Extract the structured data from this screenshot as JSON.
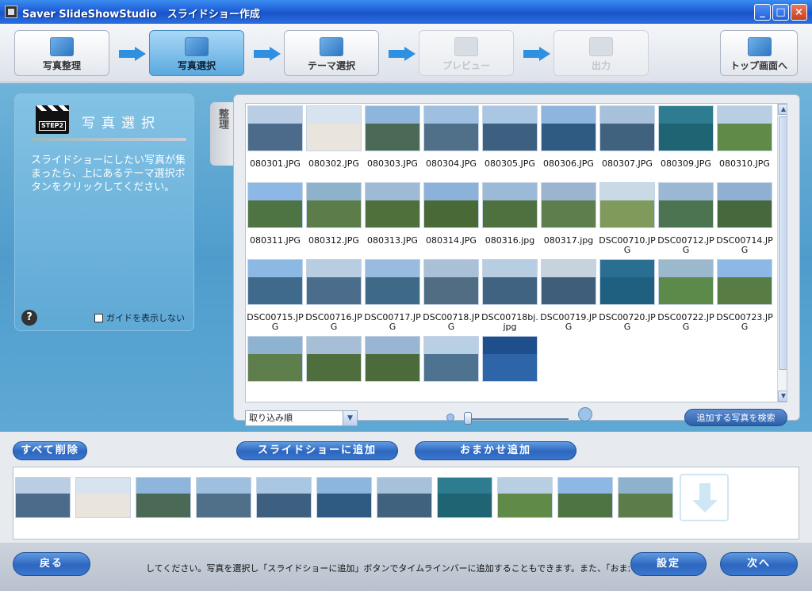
{
  "window": {
    "title": "Saver SlideShowStudio　スライドショー作成",
    "minimize": "_",
    "maximize": "□",
    "close": "×"
  },
  "steps": [
    {
      "label": "写真整理",
      "state": "normal"
    },
    {
      "label": "写真選択",
      "state": "active"
    },
    {
      "label": "テーマ選択",
      "state": "normal"
    },
    {
      "label": "プレビュー",
      "state": "disabled"
    },
    {
      "label": "出力",
      "state": "disabled"
    }
  ],
  "top_screen_button": "トップ画面へ",
  "guide": {
    "badge": "STEP2",
    "title": "写真選択",
    "text": "スライドショーにしたい写真が集まったら、上にあるテーマ選択ボタンをクリックしてください。",
    "help": "?",
    "hide_guide_label": "ガイドを表示しない"
  },
  "side_tab": "整理",
  "photos": [
    {
      "name": "080301.JPG",
      "sky": "#b9cde4",
      "ground": "#4c6b8a"
    },
    {
      "name": "080302.JPG",
      "sky": "#d7e3ee",
      "ground": "#e9e4dc"
    },
    {
      "name": "080303.JPG",
      "sky": "#8eb6dc",
      "ground": "#4b6a56"
    },
    {
      "name": "080304.JPG",
      "sky": "#9ebfe0",
      "ground": "#50708a"
    },
    {
      "name": "080305.JPG",
      "sky": "#a9c6e3",
      "ground": "#3d5f80"
    },
    {
      "name": "080306.JPG",
      "sky": "#8db5de",
      "ground": "#2f5a82"
    },
    {
      "name": "080307.JPG",
      "sky": "#a7c1da",
      "ground": "#41627f"
    },
    {
      "name": "080309.JPG",
      "sky": "#2d7c8f",
      "ground": "#1e6473"
    },
    {
      "name": "080310.JPG",
      "sky": "#b8cfe3",
      "ground": "#5f8a48"
    },
    {
      "name": "080311.JPG",
      "sky": "#8db8e6",
      "ground": "#4d7442"
    },
    {
      "name": "080312.JPG",
      "sky": "#8fb2cc",
      "ground": "#5c7d4a"
    },
    {
      "name": "080313.JPG",
      "sky": "#9fbad4",
      "ground": "#4f6f3b"
    },
    {
      "name": "080314.JPG",
      "sky": "#8cb2d9",
      "ground": "#496a36"
    },
    {
      "name": "080316.jpg",
      "sky": "#9bbad8",
      "ground": "#4f7140"
    },
    {
      "name": "080317.jpg",
      "sky": "#9bb5cf",
      "ground": "#5f7e4e"
    },
    {
      "name": "DSC00710.JPG",
      "sky": "#c9d9e6",
      "ground": "#7f9a5a"
    },
    {
      "name": "DSC00712.JPG",
      "sky": "#9ab8d4",
      "ground": "#4d7450"
    },
    {
      "name": "DSC00714.JPG",
      "sky": "#8fb0d2",
      "ground": "#47683c"
    },
    {
      "name": "DSC00715.JPG",
      "sky": "#8cb8e4",
      "ground": "#3f6a8c"
    },
    {
      "name": "DSC00716.JPG",
      "sky": "#b8cde2",
      "ground": "#4c6c8c"
    },
    {
      "name": "DSC00717.JPG",
      "sky": "#99bbe0",
      "ground": "#3e6987"
    },
    {
      "name": "DSC00718.JPG",
      "sky": "#a9c0d6",
      "ground": "#516d84"
    },
    {
      "name": "DSC00718bj.jpg",
      "sky": "#b7cde2",
      "ground": "#3f6381"
    },
    {
      "name": "DSC00719.JPG",
      "sky": "#c6d3de",
      "ground": "#3e5e7a"
    },
    {
      "name": "DSC00720.JPG",
      "sky": "#2a6f92",
      "ground": "#1f5f80"
    },
    {
      "name": "DSC00722.JPG",
      "sky": "#9cb8cc",
      "ground": "#5b8a4a"
    },
    {
      "name": "DSC00723.JPG",
      "sky": "#8db8e6",
      "ground": "#587d44"
    },
    {
      "name": "",
      "sky": "#8eb3d1",
      "ground": "#5e7e4b"
    },
    {
      "name": "",
      "sky": "#a7bfd6",
      "ground": "#4e6e3e"
    },
    {
      "name": "",
      "sky": "#98b6d4",
      "ground": "#4b6b3a"
    },
    {
      "name": "",
      "sky": "#b9cfe3",
      "ground": "#4e7390"
    },
    {
      "name": "",
      "sky": "#1f4e8c",
      "ground": "#2e64a8"
    }
  ],
  "sort_select": {
    "value": "取り込み順",
    "arrow": "▼"
  },
  "search_button": "追加する写真を検索",
  "scroll_up": "▲",
  "scroll_down": "▼",
  "buttons": {
    "delete_all": "すべて削除",
    "add_to_slideshow": "スライドショーに追加",
    "auto_add": "おまかせ追加",
    "back": "戻る",
    "settings": "設定",
    "next": "次へ"
  },
  "timeline": [
    {
      "sky": "#b9cde4",
      "ground": "#4c6b8a"
    },
    {
      "sky": "#d7e3ee",
      "ground": "#e9e4dc"
    },
    {
      "sky": "#8eb6dc",
      "ground": "#4b6a56"
    },
    {
      "sky": "#9ebfe0",
      "ground": "#50708a"
    },
    {
      "sky": "#a9c6e3",
      "ground": "#3d5f80"
    },
    {
      "sky": "#8db5de",
      "ground": "#2f5a82"
    },
    {
      "sky": "#a7c1da",
      "ground": "#41627f"
    },
    {
      "sky": "#2d7c8f",
      "ground": "#1e6473"
    },
    {
      "sky": "#b8cfe3",
      "ground": "#5f8a48"
    },
    {
      "sky": "#8db8e6",
      "ground": "#4d7442"
    },
    {
      "sky": "#8fb2cc",
      "ground": "#5c7d4a"
    }
  ],
  "ticker": "してください。写真を選択し「スライドショーに追加」ボタンでタイムラインバーに追加することもできます。また、「おまかせ追"
}
